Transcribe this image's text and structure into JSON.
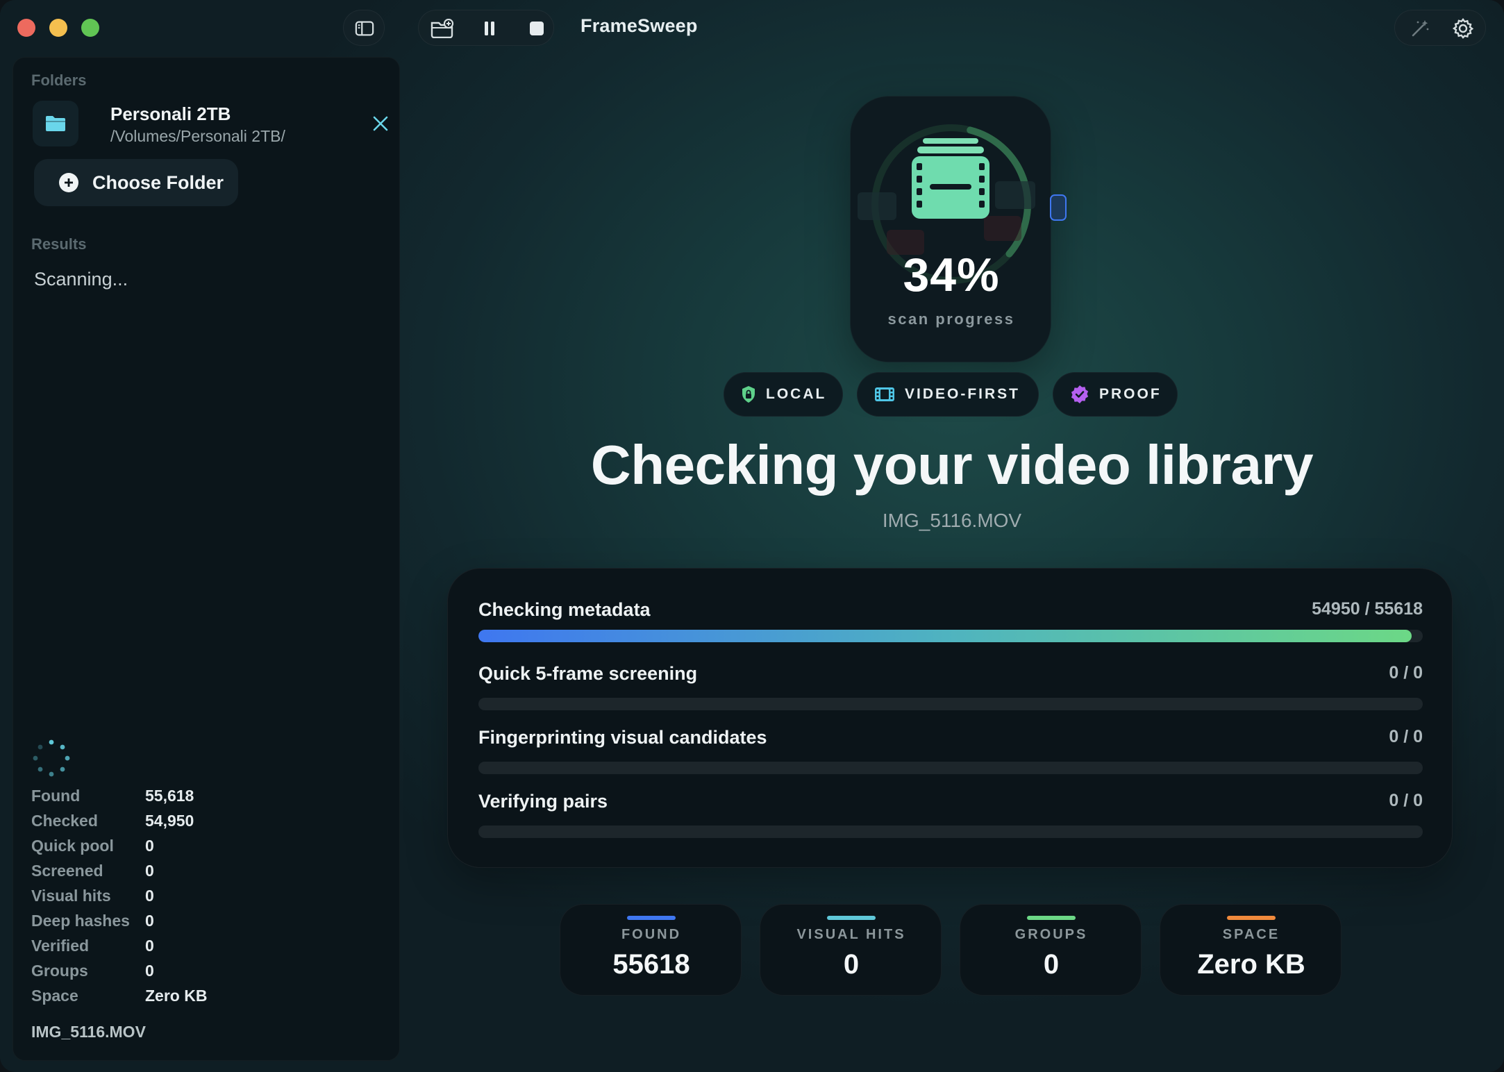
{
  "window": {
    "title": "FrameSweep"
  },
  "sidebar": {
    "folders_label": "Folders",
    "folder": {
      "name": "Personali 2TB",
      "path": "/Volumes/Personali 2TB/"
    },
    "choose_folder_label": "Choose Folder",
    "results_label": "Results",
    "results_status": "Scanning...",
    "stats": [
      {
        "label": "Found",
        "value": "55,618"
      },
      {
        "label": "Checked",
        "value": "54,950"
      },
      {
        "label": "Quick pool",
        "value": "0"
      },
      {
        "label": "Screened",
        "value": "0"
      },
      {
        "label": "Visual hits",
        "value": "0"
      },
      {
        "label": "Deep hashes",
        "value": "0"
      },
      {
        "label": "Verified",
        "value": "0"
      },
      {
        "label": "Groups",
        "value": "0"
      },
      {
        "label": "Space",
        "value": "Zero KB"
      }
    ],
    "current_file": "IMG_5116.MOV"
  },
  "hero": {
    "percent": "34%",
    "percent_value": 0.34,
    "subtitle": "scan progress",
    "badges": [
      {
        "label": "LOCAL",
        "icon": "shield-lock-icon",
        "color": "#5ed18a"
      },
      {
        "label": "VIDEO-FIRST",
        "icon": "film-icon",
        "color": "#4fc6e6"
      },
      {
        "label": "PROOF",
        "icon": "verified-seal-icon",
        "color": "#b560f0"
      }
    ],
    "headline": "Checking your video library",
    "current_file": "IMG_5116.MOV"
  },
  "stages": [
    {
      "name": "Checking metadata",
      "count": "54950 / 55618",
      "progress": 0.988
    },
    {
      "name": "Quick 5-frame screening",
      "count": "0 / 0",
      "progress": 0
    },
    {
      "name": "Fingerprinting visual candidates",
      "count": "0 / 0",
      "progress": 0
    },
    {
      "name": "Verifying pairs",
      "count": "0 / 0",
      "progress": 0
    }
  ],
  "summary": [
    {
      "label": "FOUND",
      "value": "55618",
      "accent": "#3f77f0"
    },
    {
      "label": "VISUAL HITS",
      "value": "0",
      "accent": "#5fc8d8"
    },
    {
      "label": "GROUPS",
      "value": "0",
      "accent": "#6cd886"
    },
    {
      "label": "SPACE",
      "value": "Zero KB",
      "accent": "#f08a3c"
    }
  ],
  "colors": {
    "accent_blue": "#3f77f0",
    "accent_green": "#6cd886",
    "accent_teal": "#4fc6e6"
  }
}
